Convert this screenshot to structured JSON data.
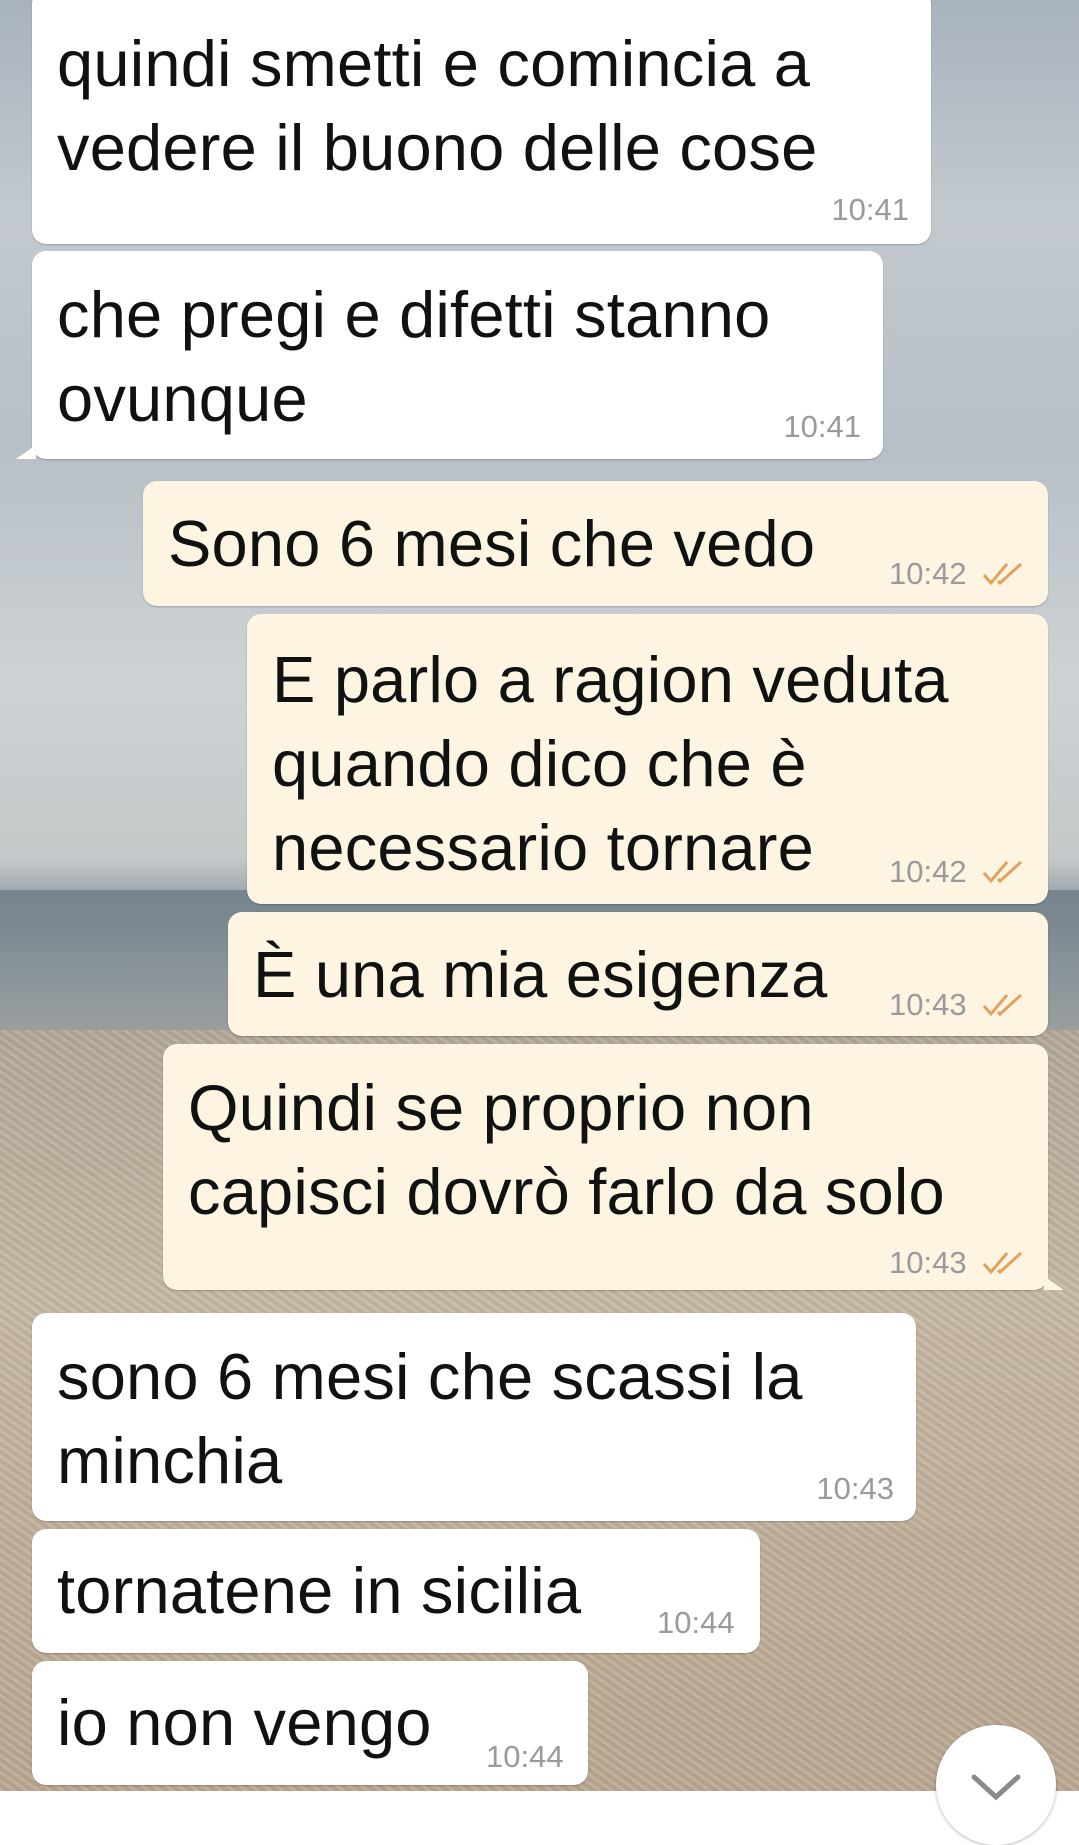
{
  "messages": [
    {
      "dir": "in",
      "text": "quindi smetti e comincia a\nvedere il buono delle cose",
      "time": "10:41"
    },
    {
      "dir": "in",
      "text": "che pregi e difetti stanno\novunque",
      "time": "10:41"
    },
    {
      "dir": "out",
      "text": "Sono 6 mesi che vedo",
      "time": "10:42",
      "status": "read"
    },
    {
      "dir": "out",
      "text": "E parlo a ragion veduta\nquando dico che è\nnecessario tornare",
      "time": "10:42",
      "status": "read"
    },
    {
      "dir": "out",
      "text": "È una mia esigenza",
      "time": "10:43",
      "status": "read"
    },
    {
      "dir": "out",
      "text": "Quindi se proprio non\ncapisci dovrò farlo da solo",
      "time": "10:43",
      "status": "read"
    },
    {
      "dir": "in",
      "text": "sono 6 mesi che scassi la\nminchia",
      "time": "10:43"
    },
    {
      "dir": "in",
      "text": "tornatene in sicilia",
      "time": "10:44"
    },
    {
      "dir": "in",
      "text": "io non vengo",
      "time": "10:44"
    }
  ],
  "scroll_button": {
    "icon": "chevron-down-icon"
  },
  "colors": {
    "incoming": "#ffffff",
    "outgoing": "#fdf5e2",
    "read_ticks": "#e3a15c",
    "timestamp": "#9a9a9a"
  }
}
